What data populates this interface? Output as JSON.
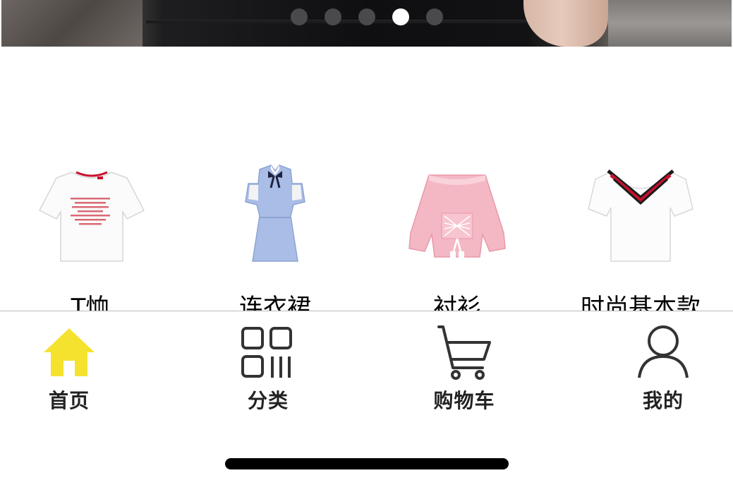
{
  "banner": {
    "slide_count": 5,
    "active_slide": 4
  },
  "categories": [
    {
      "label": "T恤",
      "icon": "tshirt-image"
    },
    {
      "label": "连衣裙",
      "icon": "dress-image"
    },
    {
      "label": "衬衫",
      "icon": "blouse-image"
    },
    {
      "label": "时尚基本款",
      "icon": "basic-top-image"
    }
  ],
  "tabbar": {
    "active_color": "#f5e22f",
    "inactive_color": "#333333",
    "tabs": [
      {
        "label": "首页",
        "icon": "home-icon",
        "active": true
      },
      {
        "label": "分类",
        "icon": "category-grid-icon",
        "active": false
      },
      {
        "label": "购物车",
        "icon": "cart-icon",
        "active": false
      },
      {
        "label": "我的",
        "icon": "user-icon",
        "active": false
      }
    ]
  }
}
